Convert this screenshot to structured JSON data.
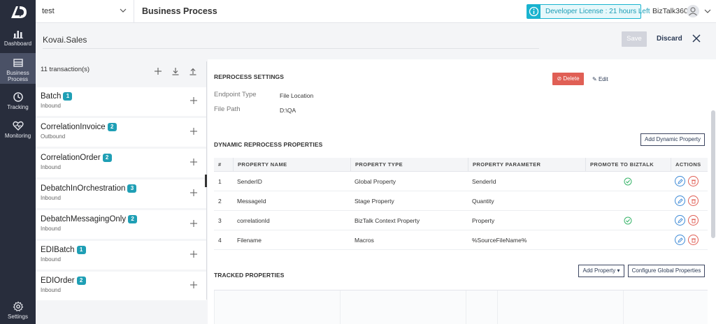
{
  "nav": {
    "items": [
      {
        "label": "Dashboard",
        "icon": "dashboard-icon"
      },
      {
        "label": "Business Process",
        "icon": "business-process-icon",
        "active": true
      },
      {
        "label": "Tracking",
        "icon": "tracking-icon"
      },
      {
        "label": "Monitoring",
        "icon": "monitoring-icon"
      },
      {
        "label": "Settings",
        "icon": "gear-icon"
      }
    ]
  },
  "header": {
    "project": "test",
    "title": "Business Process",
    "license": "Developer License : 21 hours Left",
    "user": "BizTalk360"
  },
  "subheader": {
    "name": "Kovai.Sales",
    "save_label": "Save",
    "discard_label": "Discard"
  },
  "transactions": {
    "count_label": "11 transaction(s)",
    "items": [
      {
        "name": "Batch",
        "badge": "1",
        "direction": "Inbound"
      },
      {
        "name": "CorrelationInvoice",
        "badge": "2",
        "direction": "Outbound"
      },
      {
        "name": "CorrelationOrder",
        "badge": "2",
        "direction": "Inbound"
      },
      {
        "name": "DebatchInOrchestration",
        "badge": "3",
        "direction": "Inbound"
      },
      {
        "name": "DebatchMessagingOnly",
        "badge": "2",
        "direction": "Inbound"
      },
      {
        "name": "EDIBatch",
        "badge": "1",
        "direction": "Inbound"
      },
      {
        "name": "EDIOrder",
        "badge": "2",
        "direction": "Inbound"
      }
    ]
  },
  "reprocess": {
    "title": "REPROCESS SETTINGS",
    "delete_label": "Delete",
    "edit_label": "Edit",
    "endpoint_type_label": "Endpoint Type",
    "endpoint_type_value": "File Location",
    "file_path_label": "File Path",
    "file_path_value": "D:\\QA"
  },
  "dynamic": {
    "title": "DYNAMIC REPROCESS PROPERTIES",
    "add_label": "Add Dynamic Property",
    "columns": [
      "#",
      "PROPERTY NAME",
      "PROPERTY TYPE",
      "PROPERTY PARAMETER",
      "PROMOTE TO BIZTALK",
      "ACTIONS"
    ],
    "rows": [
      {
        "num": "1",
        "name": "SenderID",
        "type": "Global Property",
        "param": "SenderId",
        "promoted": true
      },
      {
        "num": "2",
        "name": "MessageId",
        "type": "Stage Property",
        "param": "Quantity",
        "promoted": false
      },
      {
        "num": "3",
        "name": "correlationId",
        "type": "BizTalk Context Property",
        "param": "Property",
        "promoted": true
      },
      {
        "num": "4",
        "name": "Filename",
        "type": "Macros",
        "param": "%SourceFileName%",
        "promoted": false
      }
    ]
  },
  "tracked": {
    "title": "TRACKED PROPERTIES",
    "add_label": "Add Property",
    "configure_label": "Configure Global Properties"
  },
  "colors": {
    "nav_bg": "#282d3c",
    "accent": "#1f9fb5",
    "danger": "#e05f55",
    "edit": "#3e8ad6",
    "success": "#39b56a"
  }
}
